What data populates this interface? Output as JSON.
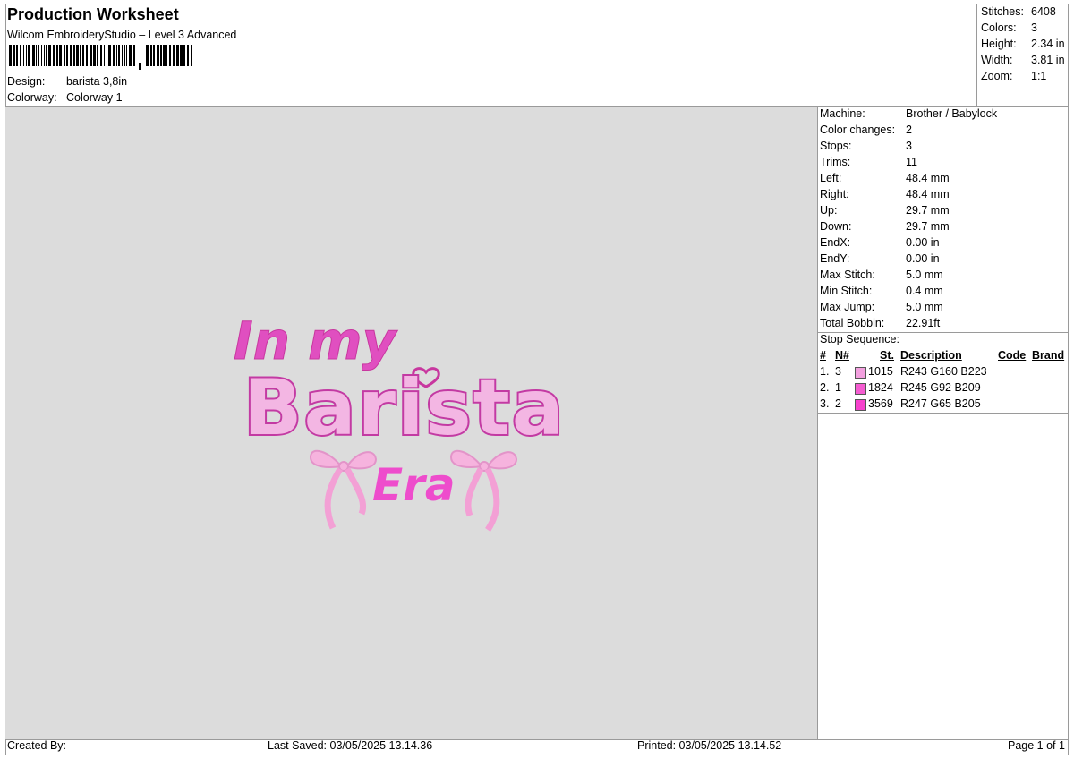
{
  "header": {
    "title": "Production Worksheet",
    "subtitle": "Wilcom EmbroideryStudio – Level 3 Advanced",
    "design_label": "Design:",
    "design_value": "barista 3,8in",
    "colorway_label": "Colorway:",
    "colorway_value": "Colorway 1"
  },
  "stats": [
    {
      "label": "Stitches:",
      "value": "6408"
    },
    {
      "label": "Colors:",
      "value": "3"
    },
    {
      "label": "Height:",
      "value": "2.34 in"
    },
    {
      "label": "Width:",
      "value": "3.81 in"
    },
    {
      "label": "Zoom:",
      "value": "1:1"
    }
  ],
  "design_text": {
    "line1": "In my",
    "line2": "Barista",
    "line3": "Era"
  },
  "machine_info": [
    {
      "label": "Machine:",
      "value": "Brother / Babylock"
    },
    {
      "label": "Color changes:",
      "value": "2"
    },
    {
      "label": "Stops:",
      "value": "3"
    },
    {
      "label": "Trims:",
      "value": "11"
    },
    {
      "label": "Left:",
      "value": "48.4 mm"
    },
    {
      "label": "Right:",
      "value": "48.4 mm"
    },
    {
      "label": "Up:",
      "value": "29.7 mm"
    },
    {
      "label": "Down:",
      "value": "29.7 mm"
    },
    {
      "label": "EndX:",
      "value": "0.00 in"
    },
    {
      "label": "EndY:",
      "value": "0.00 in"
    },
    {
      "label": "Max Stitch:",
      "value": "5.0 mm"
    },
    {
      "label": "Min Stitch:",
      "value": "0.4 mm"
    },
    {
      "label": "Max Jump:",
      "value": "5.0 mm"
    },
    {
      "label": "Total Bobbin:",
      "value": "22.91ft"
    }
  ],
  "stop_sequence": {
    "title": "Stop Sequence:",
    "headers": {
      "num": "#",
      "n": "N#",
      "st": "St.",
      "desc": "Description",
      "code": "Code",
      "brand": "Brand"
    },
    "rows": [
      {
        "num": "1.",
        "n": "3",
        "st": "1015",
        "desc": "R243 G160 B223",
        "color": "#f3a0df"
      },
      {
        "num": "2.",
        "n": "1",
        "st": "1824",
        "desc": "R245 G92 B209",
        "color": "#f55cd1"
      },
      {
        "num": "3.",
        "n": "2",
        "st": "3569",
        "desc": "R247 G65 B205",
        "color": "#f741cd"
      }
    ]
  },
  "footer": {
    "created_by": "Created By:",
    "last_saved": "Last Saved: 03/05/2025 13.14.36",
    "printed": "Printed: 03/05/2025 13.14.52",
    "page": "Page 1 of 1"
  }
}
